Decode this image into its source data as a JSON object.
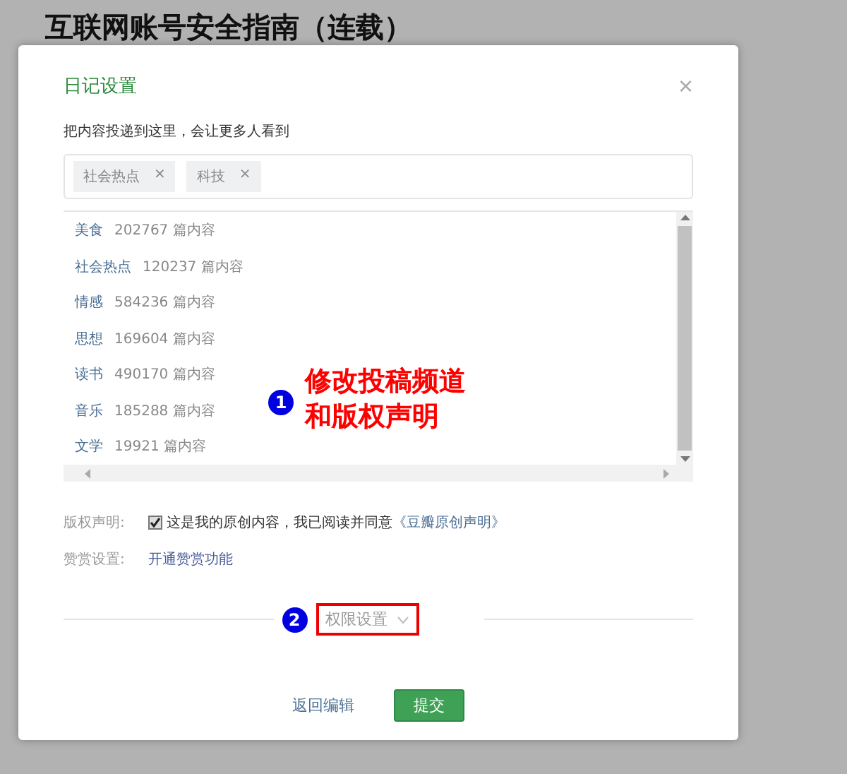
{
  "page_title": "互联网账号安全指南（连载）",
  "dialog": {
    "title": "日记设置",
    "close": "×",
    "hint": "把内容投递到这里，会让更多人看到",
    "tags": [
      {
        "label": "社会热点",
        "remove": "×"
      },
      {
        "label": "科技",
        "remove": "×"
      }
    ],
    "channels": [
      {
        "name": "美食",
        "count": "202767 篇内容"
      },
      {
        "name": "社会热点",
        "count": "120237 篇内容"
      },
      {
        "name": "情感",
        "count": "584236 篇内容"
      },
      {
        "name": "思想",
        "count": "169604 篇内容"
      },
      {
        "name": "读书",
        "count": "490170 篇内容"
      },
      {
        "name": "音乐",
        "count": "185288 篇内容"
      },
      {
        "name": "文学",
        "count": "19921 篇内容"
      }
    ],
    "copyright": {
      "label": "版权声明:",
      "checked": true,
      "text": "这是我的原创内容，我已阅读并同意",
      "link": "《豆瓣原创声明》"
    },
    "reward": {
      "label": "赞赏设置:",
      "link": "开通赞赏功能"
    },
    "permissions": {
      "label": "权限设置"
    },
    "buttons": [
      {
        "kind": "link",
        "label": "返回编辑"
      },
      {
        "kind": "primary",
        "label": "提交"
      }
    ]
  },
  "annotations": [
    {
      "number": "1",
      "lines": [
        "修改投稿频道",
        "和版权声明"
      ]
    },
    {
      "number": "2"
    }
  ]
}
